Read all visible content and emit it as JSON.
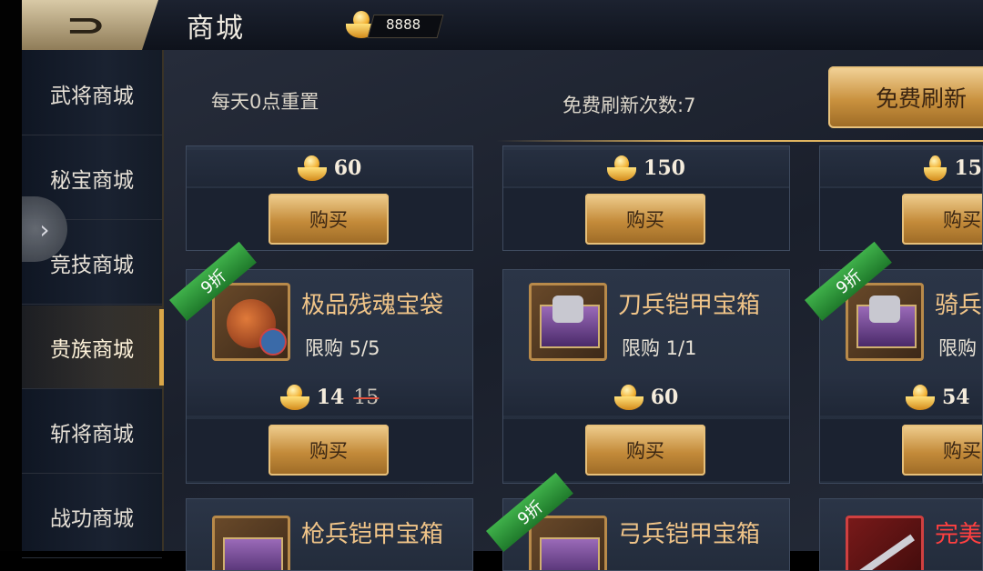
{
  "header": {
    "back_icon": "back-arrow-icon",
    "title": "商城",
    "currency_icon": "gold-ingot-icon",
    "currency_amount": "8888"
  },
  "sidebar": {
    "items": [
      {
        "label": "武将商城",
        "active": false
      },
      {
        "label": "秘宝商城",
        "active": false
      },
      {
        "label": "竞技商城",
        "active": false
      },
      {
        "label": "贵族商城",
        "active": true
      },
      {
        "label": "斩将商城",
        "active": false
      },
      {
        "label": "战功商城",
        "active": false
      }
    ],
    "expand_icon": "chevron-right-icon"
  },
  "shop": {
    "reset_note": "每天0点重置",
    "refresh_count": "免费刷新次数:7",
    "refresh_button": "免费刷新",
    "buy_label": "购买",
    "row0": [
      {
        "price": "60"
      },
      {
        "price": "150"
      },
      {
        "price": "15"
      }
    ],
    "row1": [
      {
        "badge": "9折",
        "name": "极品残魂宝袋",
        "limit": "限购 5/5",
        "price": "14",
        "original_price": "15"
      },
      {
        "badge": "",
        "name": "刀兵铠甲宝箱",
        "limit": "限购 1/1",
        "price": "60",
        "original_price": ""
      },
      {
        "badge": "9折",
        "name": "骑兵",
        "limit": "限购",
        "price": "54",
        "original_price": ""
      }
    ],
    "row2": [
      {
        "badge": "",
        "name": "枪兵铠甲宝箱"
      },
      {
        "badge": "9折",
        "name": "弓兵铠甲宝箱"
      },
      {
        "badge": "",
        "name": "完美"
      }
    ]
  }
}
